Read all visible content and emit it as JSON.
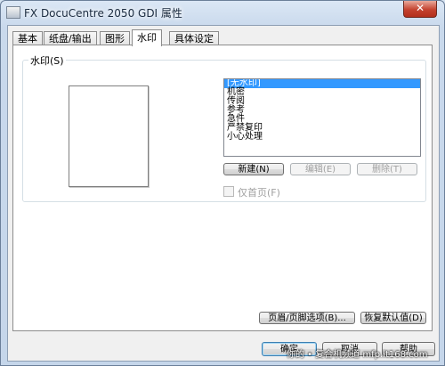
{
  "window": {
    "title": "FX DocuCentre 2050 GDI 属性",
    "close_glyph": "✕"
  },
  "tabs": [
    {
      "label": "基本"
    },
    {
      "label": "纸盘/输出"
    },
    {
      "label": "图形"
    },
    {
      "label": "水印"
    },
    {
      "label": "具体设定"
    }
  ],
  "watermark_group": {
    "label": "水印(S)",
    "list_items": [
      "[无水印]",
      "机密",
      "传阅",
      "参考",
      "急件",
      "严禁复印",
      "小心处理"
    ],
    "selected_index": 0,
    "new_button": "新建(N)",
    "edit_button": "编辑(E)",
    "delete_button": "删除(T)",
    "first_page_only": {
      "label": "仅首页(F)",
      "checked": false,
      "enabled": false
    }
  },
  "page_buttons": {
    "header_footer": "页眉/页脚选项(B)...",
    "restore_defaults": "恢复默认值(D)"
  },
  "dialog_buttons": {
    "ok": "确定",
    "cancel": "取消",
    "help": "帮助"
  },
  "overlay_watermark": "你的 • 复合机频道  mfp.it168.com"
}
